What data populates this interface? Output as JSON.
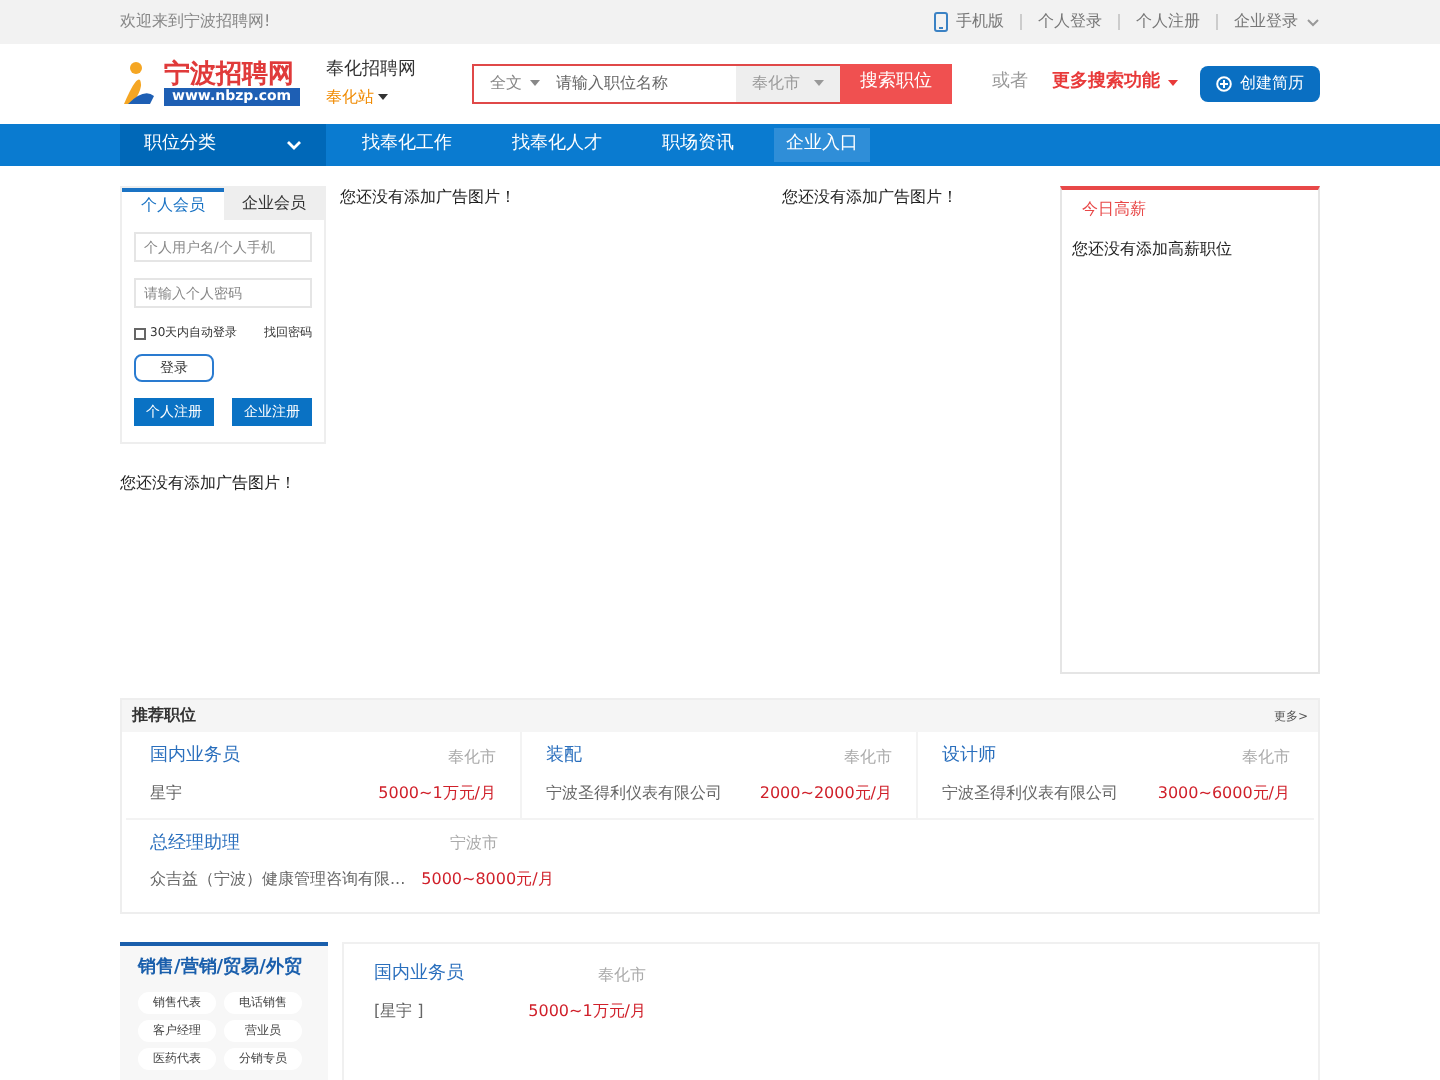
{
  "top_bar": {
    "welcome": "欢迎来到宁波招聘网!",
    "links": [
      {
        "label": "手机版",
        "kind": "phone"
      },
      {
        "label": "个人登录",
        "kind": "plain"
      },
      {
        "label": "个人注册",
        "kind": "plain"
      },
      {
        "label": "企业登录",
        "kind": "dropdown"
      }
    ]
  },
  "header": {
    "logo_name": "宁波招聘网",
    "logo_url": "www.nbzp.com",
    "site_name": "奉化招聘网",
    "station": "奉化站",
    "search": {
      "scope": "全文",
      "placeholder": "请输入职位名称",
      "city": "奉化市",
      "button": "搜索职位"
    },
    "or": "或者",
    "more_search": "更多搜索功能",
    "create_resume": "创建简历"
  },
  "nav": [
    {
      "label": "职位分类",
      "kind": "category"
    },
    {
      "label": "找奉化工作",
      "kind": "link"
    },
    {
      "label": "找奉化人才",
      "kind": "link"
    },
    {
      "label": "职场资讯",
      "kind": "link"
    },
    {
      "label": "企业入口",
      "kind": "boxed"
    }
  ],
  "login": {
    "tabs": [
      {
        "label": "个人会员",
        "selected": true
      },
      {
        "label": "企业会员",
        "selected": false
      }
    ],
    "username_placeholder": "个人用户名/个人手机",
    "password_placeholder": "请输入个人密码",
    "remember": {
      "label": "30天内自动登录",
      "checked": false
    },
    "forgot": "找回密码",
    "login_button": "登录",
    "register_personal": "个人注册",
    "register_company": "企业注册"
  },
  "ads": [
    "您还没有添加广告图片！",
    "您还没有添加广告图片！",
    "您还没有添加广告图片！"
  ],
  "high_pay": {
    "title": "今日高薪",
    "empty": "您还没有添加高薪职位"
  },
  "recommended": {
    "title": "推荐职位",
    "more": "更多>",
    "jobs": [
      {
        "title": "国内业务员",
        "city": "奉化市",
        "company": "星宇",
        "salary": "5000~1万元/月"
      },
      {
        "title": "装配",
        "city": "奉化市",
        "company": "宁波圣得利仪表有限公司",
        "salary": "2000~2000元/月"
      },
      {
        "title": "设计师",
        "city": "奉化市",
        "company": "宁波圣得利仪表有限公司",
        "salary": "3000~6000元/月"
      },
      {
        "title": "总经理助理",
        "city": "宁波市",
        "company": "众吉益（宁波）健康管理咨询有限...",
        "salary": "5000~8000元/月"
      }
    ]
  },
  "category_section": {
    "title": "销售/营销/贸易/外贸",
    "tags": [
      "销售代表",
      "电话销售",
      "客户经理",
      "营业员",
      "医药代表",
      "分销专员"
    ],
    "jobs": [
      {
        "title": "国内业务员",
        "city": "奉化市",
        "company": "[星宇 ]",
        "salary": "5000~1万元/月"
      }
    ]
  }
}
